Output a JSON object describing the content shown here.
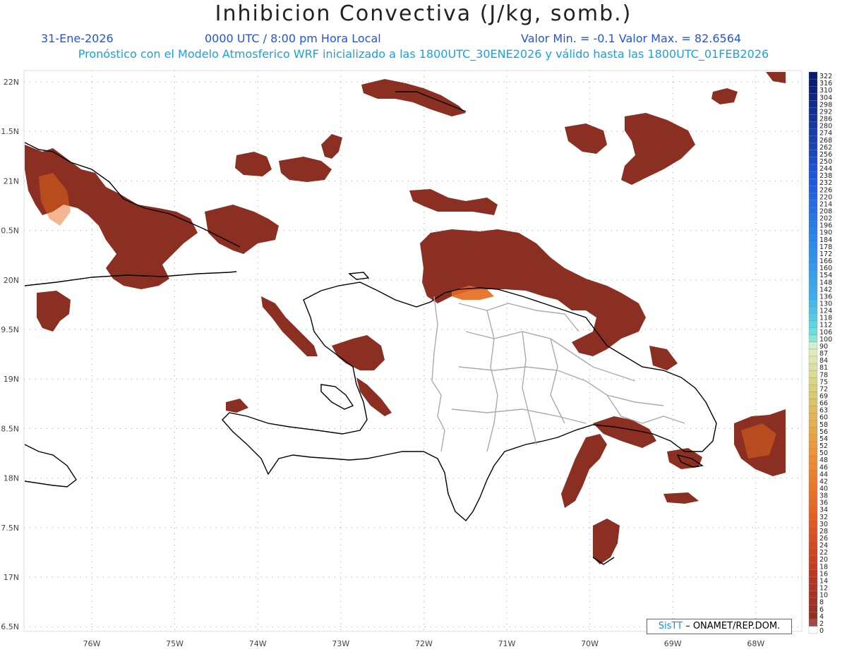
{
  "header": {
    "title": "Inhibicion Convectiva (J/kg, somb.)",
    "date": "31-Ene-2026",
    "time": "0000 UTC / 8:00 pm Hora Local",
    "minmax": "Valor Min. = -0.1  Valor Max. = 82.6564",
    "forecast": "Pronóstico con el Modelo Atmosferico WRF inicializado a las 1800UTC_30ENE2026 y válido hasta las  1800UTC_01FEB2026"
  },
  "map": {
    "lat_labels": [
      "22N",
      "21.5N",
      "21N",
      "20.5N",
      "20N",
      "19.5N",
      "19N",
      "18.5N",
      "18N",
      "17.5N",
      "17N",
      "16.5N"
    ],
    "lon_labels": [
      "76W",
      "75W",
      "74W",
      "73W",
      "72W",
      "71W",
      "70W",
      "69W",
      "68W"
    ],
    "field_color": "#8b2f22",
    "highlight_color": "#e66a1e"
  },
  "colorbar": {
    "labels": [
      "322",
      "316",
      "310",
      "304",
      "298",
      "292",
      "286",
      "280",
      "274",
      "268",
      "262",
      "256",
      "250",
      "244",
      "238",
      "232",
      "226",
      "220",
      "214",
      "208",
      "202",
      "196",
      "190",
      "184",
      "178",
      "172",
      "166",
      "160",
      "154",
      "148",
      "142",
      "136",
      "130",
      "124",
      "118",
      "112",
      "106",
      "100",
      "90",
      "87",
      "84",
      "81",
      "78",
      "75",
      "72",
      "69",
      "66",
      "63",
      "60",
      "58",
      "56",
      "54",
      "52",
      "50",
      "48",
      "46",
      "44",
      "42",
      "40",
      "38",
      "36",
      "34",
      "32",
      "30",
      "28",
      "26",
      "24",
      "22",
      "20",
      "18",
      "16",
      "14",
      "12",
      "10",
      "8",
      "6",
      "4",
      "2",
      "0"
    ],
    "colors": {
      "top": "#0a1a6e",
      "mid": "#3aa6f0",
      "teal": "#6fe6d8",
      "yellow": "#d8c870",
      "orange": "#f0781e",
      "red": "#c03a22",
      "dark": "#8a2f28",
      "zero": "#ffffff"
    }
  },
  "credit": {
    "brand": "SisTT",
    "text": " – ONAMET/REP.DOM."
  }
}
